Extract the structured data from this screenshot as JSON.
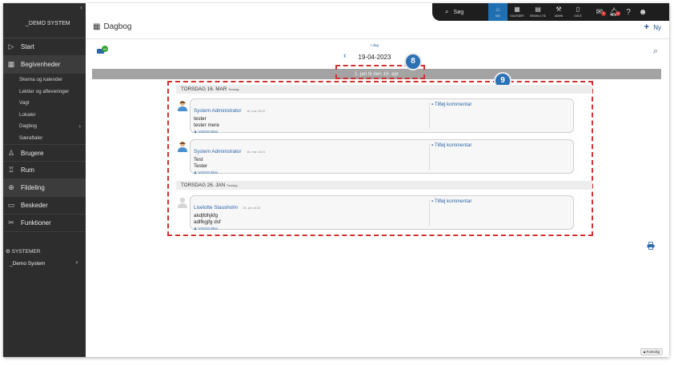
{
  "app": {
    "system_name": "_DEMO SYSTEM",
    "collapse_glyph": "‹"
  },
  "sidebar": {
    "start_label": "Start",
    "events_label": "Begivenheder",
    "events_sub": [
      "Skema og kalender",
      "Lektier og afleveringer",
      "Vagt",
      "Lokaler",
      "Dagbog",
      "Særaftaler"
    ],
    "users_label": "Brugere",
    "rooms_label": "Rum",
    "sharing_label": "Fildeling",
    "messages_label": "Beskeder",
    "functions_label": "Funktioner",
    "systems_label": "SYSTEMER",
    "demo_system_label": "_Demo System"
  },
  "topbar": {
    "search_label": "Søg",
    "items": [
      "MIG",
      "KALENDER",
      "SKEMA & TID",
      "ADMIN",
      "DOCS"
    ],
    "mail_badge": "3",
    "bell_badge": "10"
  },
  "header": {
    "title": "Dagbog",
    "new_label": "Ny"
  },
  "toolbar": {
    "chat_badge": "4/4",
    "today_label": "I dag",
    "current_date": "19-04-2023",
    "range_label": "1. jan til den 19. apr"
  },
  "callouts": {
    "badge_8": "8",
    "badge_9": "9"
  },
  "days": [
    {
      "header": "TORSDAG 16. MAR",
      "weekday": "Torsdag",
      "entries": [
        {
          "author": "System Administrator",
          "time": "16. mar 15:22",
          "lines": [
            "tester",
            "tester mere"
          ],
          "audience": "VIGGO Elev",
          "comment": "Tilføj kommentar"
        },
        {
          "author": "System Administrator",
          "time": "16. mar 15:21",
          "lines": [
            "Test",
            "Tester"
          ],
          "audience": "VIGGO Elev",
          "comment": "Tilføj kommentar"
        }
      ]
    },
    {
      "header": "TORSDAG 26. JAN",
      "weekday": "Torsdag",
      "entries": [
        {
          "author": "Liselotte Stausholm",
          "time": "26. jan 14:33",
          "lines": [
            "akdjfdhjkfg",
            "adlfkgjfg dsf"
          ],
          "audience": "VIGGO Elev",
          "comment": "Tilføj kommentar"
        }
      ]
    }
  ],
  "footer": {
    "privacy_label": "Fortrolig"
  },
  "colors": {
    "accent": "#2c66a8",
    "callout": "#d0312d",
    "badge": "#2b71b4",
    "sidebar": "#2d2d2d",
    "chat_badge": "#3aa335"
  }
}
